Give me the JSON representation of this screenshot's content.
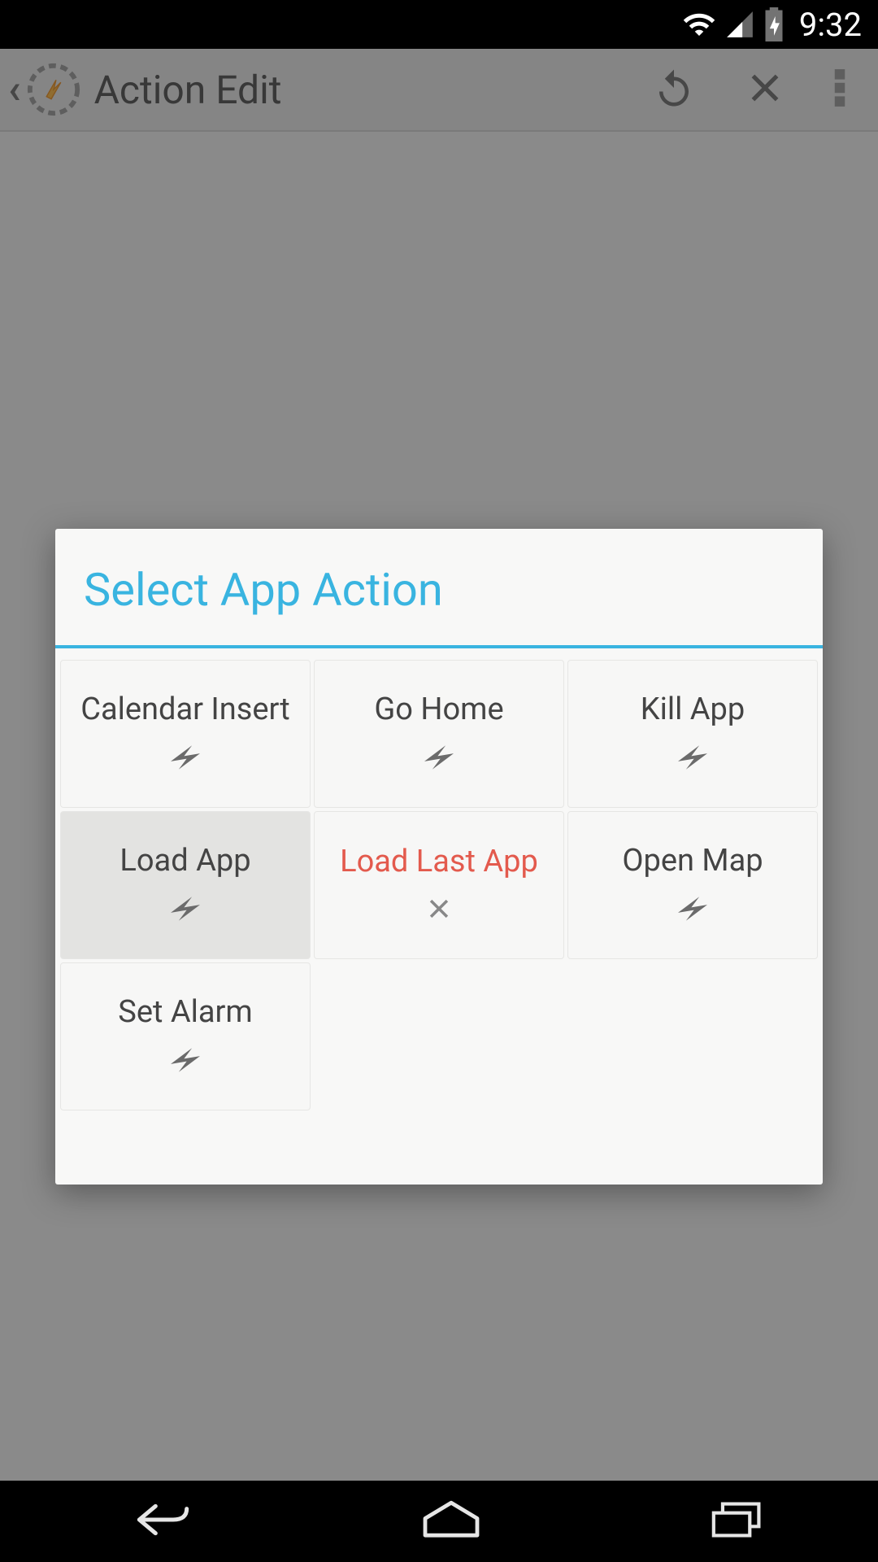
{
  "statusbar": {
    "time": "9:32"
  },
  "actionbar": {
    "title": "Action Edit"
  },
  "dialog": {
    "title": "Select App Action",
    "tiles": [
      {
        "label": "Calendar Insert",
        "icon": "bolt",
        "selected": false,
        "unavailable": false
      },
      {
        "label": "Go Home",
        "icon": "bolt",
        "selected": false,
        "unavailable": false
      },
      {
        "label": "Kill App",
        "icon": "bolt",
        "selected": false,
        "unavailable": false
      },
      {
        "label": "Load App",
        "icon": "bolt",
        "selected": true,
        "unavailable": false
      },
      {
        "label": "Load Last App",
        "icon": "cross",
        "selected": false,
        "unavailable": true
      },
      {
        "label": "Open Map",
        "icon": "bolt",
        "selected": false,
        "unavailable": false
      },
      {
        "label": "Set Alarm",
        "icon": "bolt",
        "selected": false,
        "unavailable": false
      }
    ]
  }
}
